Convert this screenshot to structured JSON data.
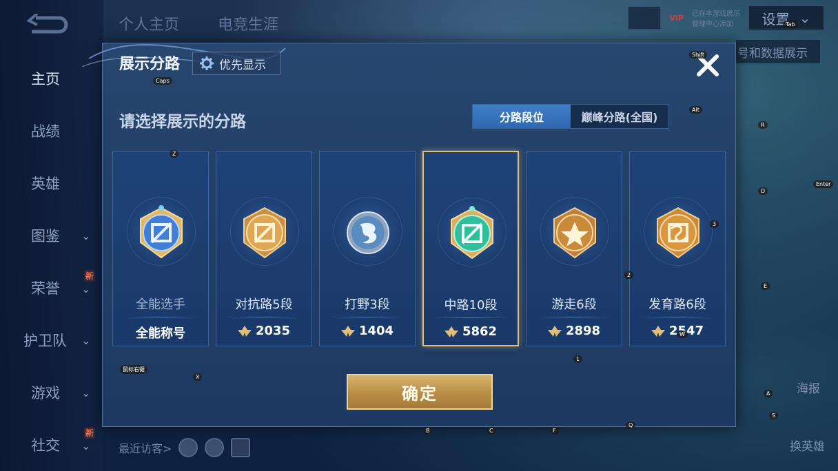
{
  "nav": {
    "items": [
      {
        "label": "主页",
        "active": true
      },
      {
        "label": "战绩"
      },
      {
        "label": "英雄"
      },
      {
        "label": "图鉴"
      },
      {
        "label": "荣誉",
        "badge": "新"
      },
      {
        "label": "护卫队"
      },
      {
        "label": "游戏"
      },
      {
        "label": "社交",
        "badge": "新"
      }
    ]
  },
  "top_tabs": [
    "个人主页",
    "电竞生涯"
  ],
  "top_right": {
    "vip_label": "VIP",
    "vip_text1": "已在本游戏展示",
    "vip_text2": "管理中心添加",
    "settings_label": "设置"
  },
  "behind": {
    "data_show_text": "号和数据展示",
    "poster_label": "海报",
    "change_hero_label": "换英雄"
  },
  "recent_visitors_label": "最近访客>",
  "modal": {
    "title": "展示分路",
    "priority_label": "优先显示",
    "subtitle": "请选择展示的分路",
    "segments": [
      {
        "label": "分路段位",
        "active": true
      },
      {
        "label": "巅峰分路(全国)",
        "active": false
      }
    ],
    "cards": [
      {
        "name": "全能选手",
        "score": "全能称号",
        "has_icon": false,
        "color": "#3f7fd6",
        "selected": false
      },
      {
        "name": "对抗路5段",
        "score": "2035",
        "has_icon": true,
        "color": "#d89a48",
        "selected": false
      },
      {
        "name": "打野3段",
        "score": "1404",
        "has_icon": true,
        "color": "#6aa6d8",
        "selected": false
      },
      {
        "name": "中路10段",
        "score": "5862",
        "has_icon": true,
        "color": "#2fbf9c",
        "selected": true
      },
      {
        "name": "游走6段",
        "score": "2898",
        "has_icon": true,
        "color": "#c98a3a",
        "selected": false
      },
      {
        "name": "发育路6段",
        "score": "2547",
        "has_icon": true,
        "color": "#d08a3c",
        "selected": false
      }
    ],
    "confirm_label": "确定"
  },
  "key_hints": [
    "Caps",
    "Z",
    "Shift",
    "Alt",
    "R",
    "D",
    "Enter",
    "3",
    "2",
    "E",
    "1",
    "X",
    "A",
    "S",
    "B",
    "C",
    "F",
    "Q",
    "W",
    "鼠标右键",
    "Tab"
  ]
}
